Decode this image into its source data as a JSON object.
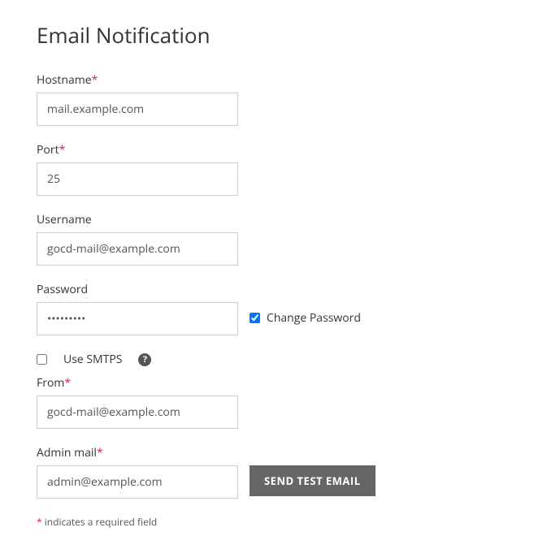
{
  "title": "Email Notification",
  "fields": {
    "hostname": {
      "label": "Hostname",
      "required": true,
      "value": "mail.example.com"
    },
    "port": {
      "label": "Port",
      "required": true,
      "value": "25"
    },
    "username": {
      "label": "Username",
      "required": false,
      "value": "gocd-mail@example.com"
    },
    "password": {
      "label": "Password",
      "required": false,
      "value": "•••••••••"
    },
    "change_password": {
      "label": "Change Password",
      "checked": true
    },
    "use_smtps": {
      "label": "Use SMTPS",
      "checked": false
    },
    "from": {
      "label": "From",
      "required": true,
      "value": "gocd-mail@example.com"
    },
    "admin_mail": {
      "label": "Admin mail",
      "required": true,
      "value": "admin@example.com"
    }
  },
  "buttons": {
    "send_test": "SEND TEST EMAIL"
  },
  "footnote": {
    "marker": "*",
    "text": " indicates a required field"
  },
  "required_marker": "*"
}
